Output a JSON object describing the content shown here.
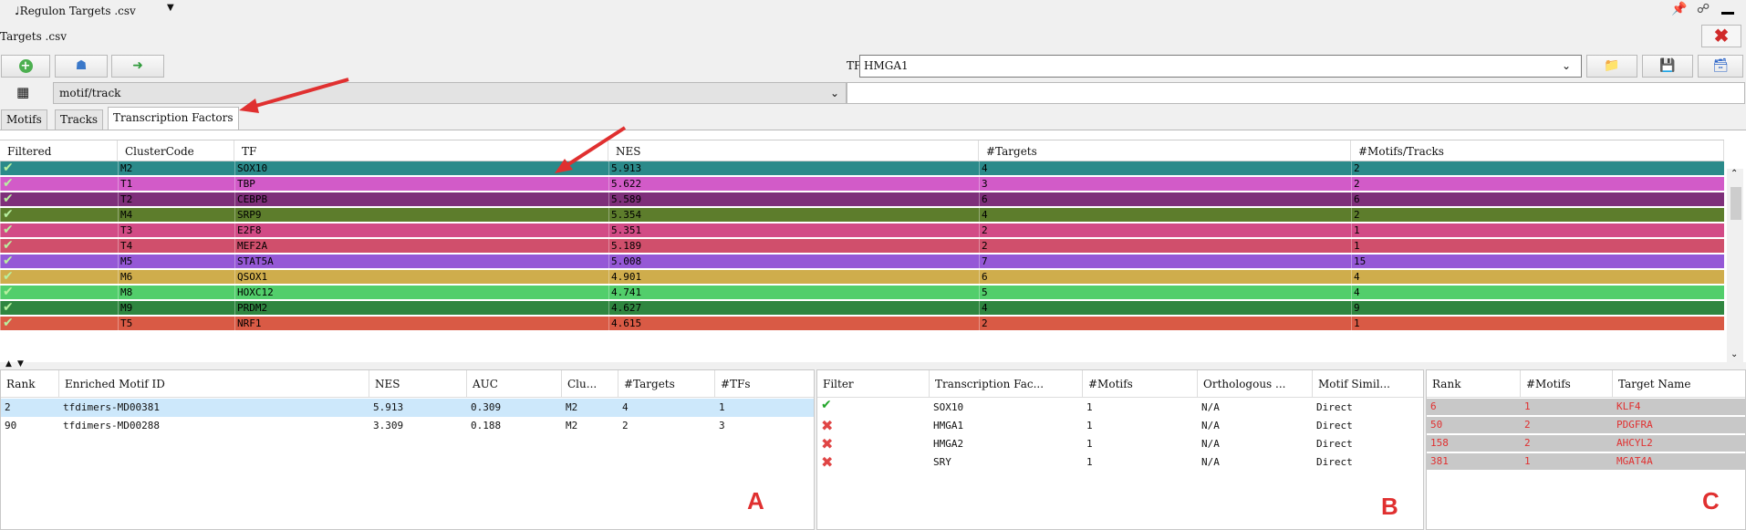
{
  "window": {
    "title": "♩Regulon Targets .csv",
    "file_label": "Targets .csv"
  },
  "toolbar": {
    "tf_label": "TF",
    "tf_value": "HMGA1"
  },
  "motif_track": {
    "value": "motif/track"
  },
  "tabs": [
    {
      "label": "Motifs"
    },
    {
      "label": "Tracks"
    },
    {
      "label": "Transcription Factors",
      "active": true
    }
  ],
  "main_table": {
    "columns": [
      "Filtered",
      "ClusterCode",
      "TF",
      "NES",
      "#Targets",
      "#Motifs/Tracks"
    ],
    "rows": [
      {
        "cluster": "M2",
        "tf": "SOX10",
        "nes": "5.913",
        "targets": "4",
        "motifs": "2",
        "color": "#2b8a8a"
      },
      {
        "cluster": "T1",
        "tf": "TBP",
        "nes": "5.622",
        "targets": "3",
        "motifs": "2",
        "color": "#d25bc8"
      },
      {
        "cluster": "T2",
        "tf": "CEBPB",
        "nes": "5.589",
        "targets": "6",
        "motifs": "6",
        "color": "#7e2f7a"
      },
      {
        "cluster": "M4",
        "tf": "SRP9",
        "nes": "5.354",
        "targets": "4",
        "motifs": "2",
        "color": "#5d7d2c"
      },
      {
        "cluster": "T3",
        "tf": "E2F8",
        "nes": "5.351",
        "targets": "2",
        "motifs": "1",
        "color": "#d24b86"
      },
      {
        "cluster": "T4",
        "tf": "MEF2A",
        "nes": "5.189",
        "targets": "2",
        "motifs": "1",
        "color": "#d04f6c"
      },
      {
        "cluster": "M5",
        "tf": "STAT5A",
        "nes": "5.008",
        "targets": "7",
        "motifs": "15",
        "color": "#9558d6"
      },
      {
        "cluster": "M6",
        "tf": "QSOX1",
        "nes": "4.901",
        "targets": "6",
        "motifs": "4",
        "color": "#cfad4c"
      },
      {
        "cluster": "M8",
        "tf": "HOXC12",
        "nes": "4.741",
        "targets": "5",
        "motifs": "4",
        "color": "#52ce6b"
      },
      {
        "cluster": "M9",
        "tf": "PRDM2",
        "nes": "4.627",
        "targets": "4",
        "motifs": "9",
        "color": "#2f8640"
      },
      {
        "cluster": "T5",
        "tf": "NRF1",
        "nes": "4.615",
        "targets": "2",
        "motifs": "1",
        "color": "#d95a45"
      }
    ]
  },
  "panel_a": {
    "columns": [
      "Rank",
      "Enriched Motif ID",
      "NES",
      "AUC",
      "Clu...",
      "#Targets",
      "#TFs"
    ],
    "rows": [
      {
        "rank": "2",
        "motif_id": "tfdimers-MD00381",
        "nes": "5.913",
        "auc": "0.309",
        "clu": "M2",
        "targets": "4",
        "tfs": "1",
        "selected": true
      },
      {
        "rank": "90",
        "motif_id": "tfdimers-MD00288",
        "nes": "3.309",
        "auc": "0.188",
        "clu": "M2",
        "targets": "2",
        "tfs": "3",
        "selected": false
      }
    ],
    "label": "A"
  },
  "panel_b": {
    "columns": [
      "Filter",
      "Transcription Fac...",
      "#Motifs",
      "Orthologous ...",
      "Motif Simil..."
    ],
    "rows": [
      {
        "pass": true,
        "tf": "SOX10",
        "motifs": "1",
        "ortho": "N/A",
        "sim": "Direct"
      },
      {
        "pass": false,
        "tf": "HMGA1",
        "motifs": "1",
        "ortho": "N/A",
        "sim": "Direct"
      },
      {
        "pass": false,
        "tf": "HMGA2",
        "motifs": "1",
        "ortho": "N/A",
        "sim": "Direct"
      },
      {
        "pass": false,
        "tf": "SRY",
        "motifs": "1",
        "ortho": "N/A",
        "sim": "Direct"
      }
    ],
    "label": "B"
  },
  "panel_c": {
    "columns": [
      "Rank",
      "#Motifs",
      "Target Name"
    ],
    "rows": [
      {
        "rank": "6",
        "motifs": "1",
        "target": "KLF4"
      },
      {
        "rank": "50",
        "motifs": "2",
        "target": "PDGFRA"
      },
      {
        "rank": "158",
        "motifs": "2",
        "target": "AHCYL2"
      },
      {
        "rank": "381",
        "motifs": "1",
        "target": "MGAT4A"
      }
    ],
    "label": "C"
  },
  "icons": {
    "pin": "pin-icon",
    "float": "float-icon",
    "minimize": "minimize-icon",
    "close": "close-icon",
    "add": "add-icon",
    "tree": "tree-icon",
    "export": "export-icon",
    "folder": "folder-icon",
    "save": "save-icon",
    "save_as": "save-as-icon",
    "database": "database-icon"
  },
  "colors": {
    "check": "#22a52a",
    "cross": "#e04545",
    "annotation": "#e03030",
    "selected_row": "#cde8fb",
    "panel_c_row": "#c8c8c8"
  }
}
